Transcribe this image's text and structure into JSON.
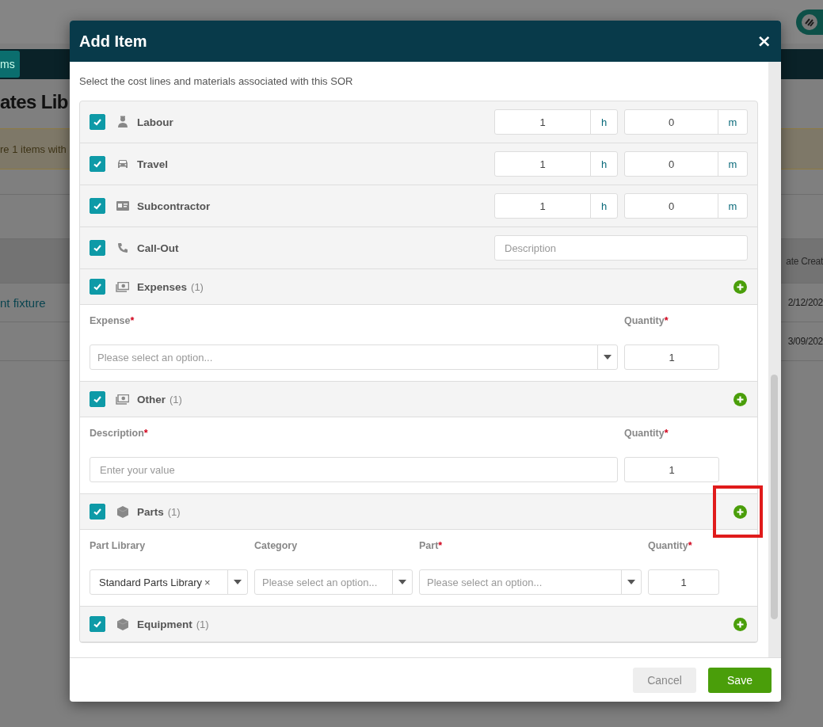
{
  "background": {
    "nav_button": "ms",
    "page_title": "ates Lib",
    "banner": "re 1 items with",
    "table_header": "ate Creat",
    "rows": [
      {
        "name": "nt fixture",
        "date": "2/12/202"
      },
      {
        "date": "3/09/202"
      }
    ]
  },
  "modal": {
    "title": "Add Item",
    "close": "×",
    "intro": "Select the cost lines and materials associated with this SOR",
    "lines": [
      {
        "kind": "time",
        "label": "Labour",
        "checked": true,
        "hours": "1",
        "hours_unit": "h",
        "minutes": "0",
        "minutes_unit": "m"
      },
      {
        "kind": "time",
        "label": "Travel",
        "checked": true,
        "hours": "1",
        "hours_unit": "h",
        "minutes": "0",
        "minutes_unit": "m"
      },
      {
        "kind": "time",
        "label": "Subcontractor",
        "checked": true,
        "hours": "1",
        "hours_unit": "h",
        "minutes": "0",
        "minutes_unit": "m"
      },
      {
        "kind": "text",
        "label": "Call-Out",
        "checked": true,
        "placeholder": "Description"
      },
      {
        "kind": "group",
        "label": "Expenses",
        "count": "(1)",
        "checked": true,
        "fields": [
          {
            "kind": "select",
            "label": "Expense",
            "required_mark": "*",
            "placeholder": "Please select an option..."
          },
          {
            "kind": "number",
            "label": "Quantity",
            "required_mark": "*",
            "value": "1"
          }
        ]
      },
      {
        "kind": "group",
        "label": "Other",
        "count": "(1)",
        "checked": true,
        "fields": [
          {
            "kind": "input",
            "label": "Description",
            "required_mark": "*",
            "placeholder": "Enter your value"
          },
          {
            "kind": "number",
            "label": "Quantity",
            "required_mark": "*",
            "value": "1"
          }
        ]
      },
      {
        "kind": "group",
        "label": "Parts",
        "count": "(1)",
        "checked": true,
        "highlighted": true,
        "fields": [
          {
            "kind": "select",
            "label": "Part Library",
            "value": "Standard Parts Library",
            "clear": "×"
          },
          {
            "kind": "select",
            "label": "Category",
            "placeholder": "Please select an option..."
          },
          {
            "kind": "select",
            "label": "Part",
            "required_mark": "*",
            "placeholder": "Please select an option..."
          },
          {
            "kind": "number",
            "label": "Quantity",
            "required_mark": "*",
            "value": "1"
          }
        ]
      },
      {
        "kind": "group",
        "label": "Equipment",
        "count": "(1)",
        "checked": true
      }
    ],
    "buttons": [
      {
        "kind": "secondary",
        "label": "Cancel"
      },
      {
        "kind": "primary",
        "label": "Save"
      }
    ]
  }
}
